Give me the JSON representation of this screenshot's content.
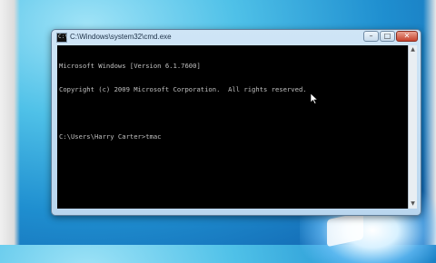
{
  "window": {
    "title": "C:\\Windows\\system32\\cmd.exe",
    "title_icon_text": "C:\\",
    "buttons": {
      "minimize": "–",
      "maximize": "□",
      "close": "✕"
    }
  },
  "console": {
    "lines": [
      "Microsoft Windows [Version 6.1.7600]",
      "Copyright (c) 2009 Microsoft Corporation.  All rights reserved."
    ],
    "prompt": "C:\\Users\\Harry Carter>tmac"
  },
  "scrollbar": {
    "up_arrow": "▲",
    "down_arrow": "▼"
  },
  "colors": {
    "console_bg": "#000000",
    "console_text": "#c0c0c0",
    "desktop_accent": "#1f8fd0"
  }
}
